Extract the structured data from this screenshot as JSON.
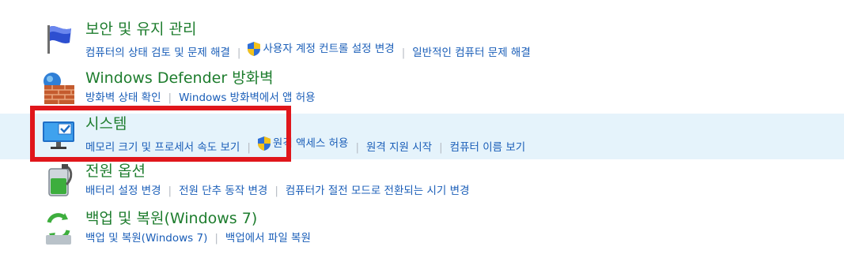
{
  "categories": [
    {
      "icon": "flag-icon",
      "title": "보안 및 유지 관리",
      "links": [
        "컴퓨터의 상태 검토 및 문제 해결",
        "사용자 계정 컨트롤 설정 변경",
        "일반적인 컴퓨터 문제 해결"
      ]
    },
    {
      "icon": "firewall-icon",
      "title": "Windows Defender 방화벽",
      "links": [
        "방화벽 상태 확인",
        "Windows 방화벽에서 앱 허용"
      ]
    },
    {
      "icon": "monitor-icon",
      "title": "시스템",
      "links": [
        "메모리 크기 및 프로세서 속도 보기",
        "원격 액세스 허용",
        "원격 지원 시작",
        "컴퓨터 이름 보기"
      ]
    },
    {
      "icon": "battery-icon",
      "title": "전원 옵션",
      "links": [
        "배터리 설정 변경",
        "전원 단추 동작 변경",
        "컴퓨터가 절전 모드로 전환되는 시기 변경"
      ]
    },
    {
      "icon": "backup-icon",
      "title": "백업 및 복원(Windows 7)",
      "links": [
        "백업 및 복원(Windows 7)",
        "백업에서 파일 복원"
      ]
    }
  ],
  "colors": {
    "title": "#1e7d2e",
    "link": "#1a5eb8",
    "selected_background": "#e5f3fb",
    "highlight_border": "#e0161b"
  }
}
